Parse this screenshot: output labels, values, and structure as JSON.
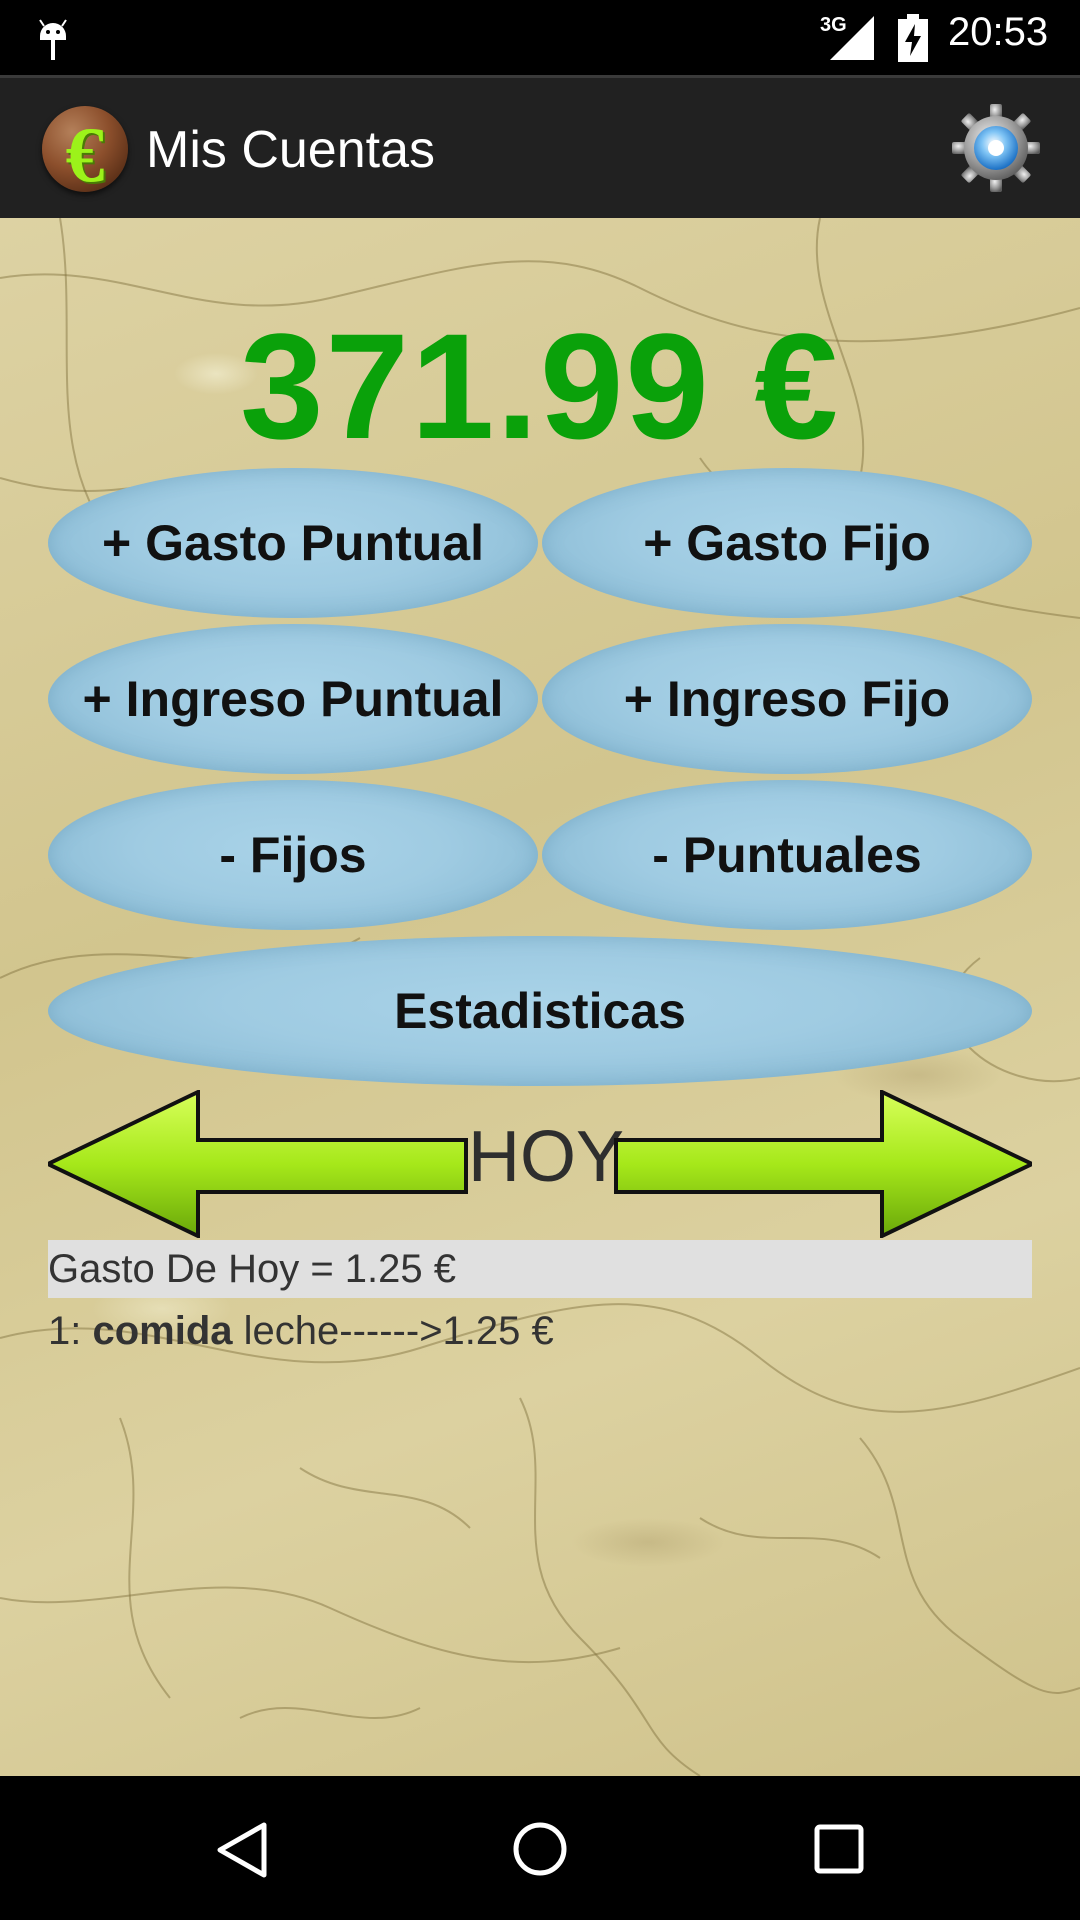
{
  "status_bar": {
    "network": "3G",
    "time": "20:53",
    "icons": [
      "android-debug-icon",
      "signal-icon",
      "battery-charging-icon"
    ]
  },
  "app_bar": {
    "title": "Mis Cuentas",
    "logo_icon": "euro-coin-icon",
    "settings_icon": "gear-icon"
  },
  "main": {
    "balance": "371.99 €",
    "balance_color": "#0aa10a",
    "buttons": {
      "gasto_puntual": "+ Gasto Puntual",
      "gasto_fijo": "+ Gasto Fijo",
      "ingreso_puntual": "+ Ingreso Puntual",
      "ingreso_fijo": "+ Ingreso Fijo",
      "fijos": "- Fijos",
      "puntuales": "- Puntuales",
      "estadisticas": "Estadisticas"
    },
    "day_nav": {
      "label": "HOY",
      "prev_icon": "left-arrow-icon",
      "next_icon": "right-arrow-icon",
      "arrow_color": "#a6e81a"
    },
    "summary": "Gasto De Hoy = 1.25 €",
    "entries": [
      {
        "index": "1: ",
        "category": "comida",
        "detail": " leche------>1.25 €"
      }
    ]
  },
  "nav_bar": {
    "icons": [
      "back-icon",
      "home-icon",
      "recents-icon"
    ]
  }
}
